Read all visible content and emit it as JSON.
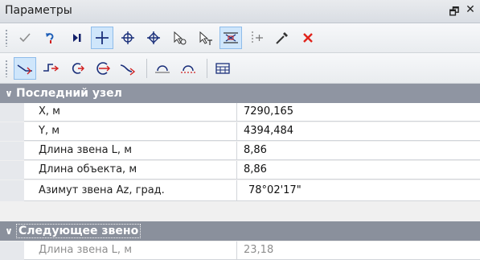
{
  "window": {
    "title": "Параметры",
    "controls": [
      "float-icon",
      "close-icon"
    ]
  },
  "toolbar1": {
    "buttons": [
      {
        "name": "check-icon"
      },
      {
        "name": "undo-arrow-icon"
      },
      {
        "name": "step-forward-icon"
      },
      {
        "name": "crosshair-icon",
        "active": true
      },
      {
        "name": "circle-cross-icon"
      },
      {
        "name": "diamond-cross-icon"
      },
      {
        "name": "pointer-o-icon"
      },
      {
        "name": "pointer-t-icon"
      },
      {
        "name": "snap-grid-icon",
        "active": true
      },
      {
        "name": "split-line-icon"
      },
      {
        "name": "eyedropper-icon"
      },
      {
        "name": "delete-icon"
      }
    ]
  },
  "toolbar2": {
    "buttons": [
      {
        "name": "line-node-icon",
        "active": true
      },
      {
        "name": "step-node-icon"
      },
      {
        "name": "arc-arrow-icon"
      },
      {
        "name": "arc-cross-icon"
      },
      {
        "name": "curve-node-icon"
      },
      {
        "name": "circle-base-icon"
      },
      {
        "name": "circle-dashed-icon"
      },
      {
        "name": "table-icon"
      }
    ]
  },
  "sections": [
    {
      "title": "Последний узел",
      "rows": [
        {
          "label": "X, м",
          "value": "7290,165"
        },
        {
          "label": "Y, м",
          "value": "4394,484"
        },
        {
          "label": "Длина звена L, м",
          "value": "8,86"
        },
        {
          "label": "Длина объекта, м",
          "value": "8,86"
        },
        {
          "label": "Азимут звена Az, град.",
          "value": "78°02'17\""
        }
      ]
    },
    {
      "title": "Следующее звено",
      "rows": [
        {
          "label": "Длина звена L, м",
          "value": "23,18"
        }
      ]
    }
  ],
  "colors": {
    "accent": "#cfe6fb",
    "group_header": "#8f95a2",
    "delete": "#e0231b"
  }
}
